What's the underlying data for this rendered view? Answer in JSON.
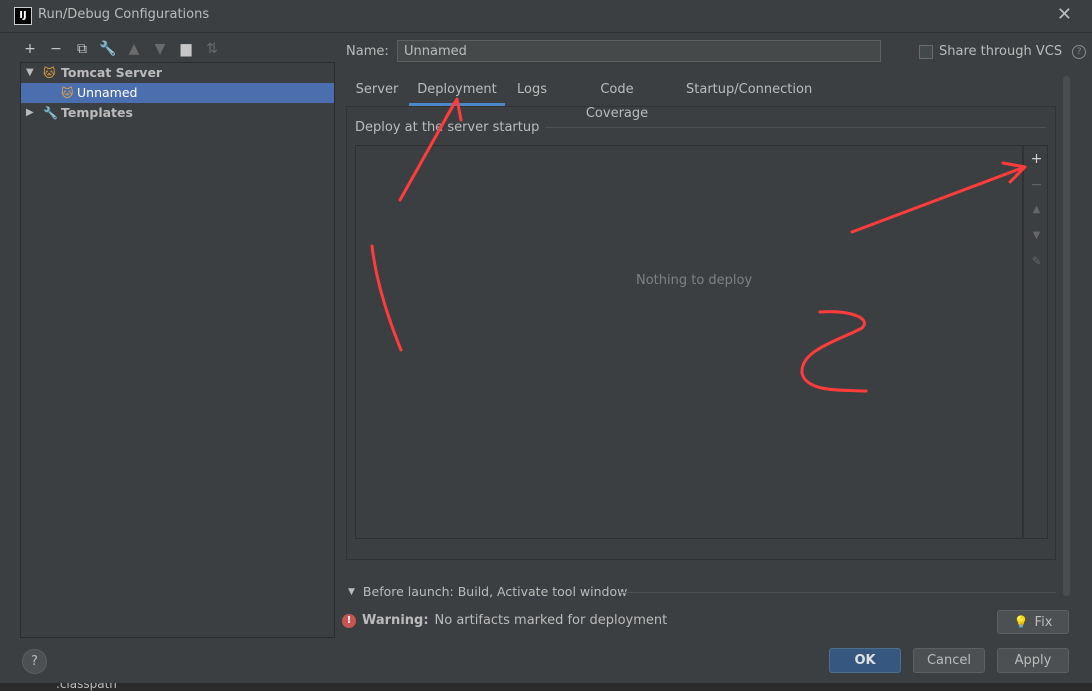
{
  "window": {
    "title": "Run/Debug Configurations",
    "app_icon_text": "IJ"
  },
  "toolbar": {
    "icons": [
      "add-icon",
      "remove-icon",
      "copy-icon",
      "wrench-icon",
      "move-up-icon",
      "move-down-icon",
      "folder-icon",
      "sort-icon"
    ]
  },
  "tree": {
    "group_label": "Tomcat Server",
    "selected_item": "Unnamed",
    "templates_label": "Templates"
  },
  "form": {
    "name_label": "Name:",
    "name_value": "Unnamed",
    "share_label": "Share through VCS"
  },
  "tabs": [
    "Server",
    "Deployment",
    "Logs",
    "Code Coverage",
    "Startup/Connection"
  ],
  "active_tab": "Deployment",
  "deployment": {
    "section_title": "Deploy at the server startup",
    "empty_text": "Nothing to deploy"
  },
  "before_launch": "Before launch: Build, Activate tool window",
  "warning": {
    "bold": "Warning:",
    "text": "No artifacts marked for deployment"
  },
  "buttons": {
    "fix": "Fix",
    "ok": "OK",
    "cancel": "Cancel",
    "apply": "Apply",
    "help": "?"
  },
  "annotations": {
    "label_1": "1",
    "label_2": "2",
    "color": "#ff3b3b"
  },
  "bottom_strip": {
    "text": ".classpath"
  }
}
